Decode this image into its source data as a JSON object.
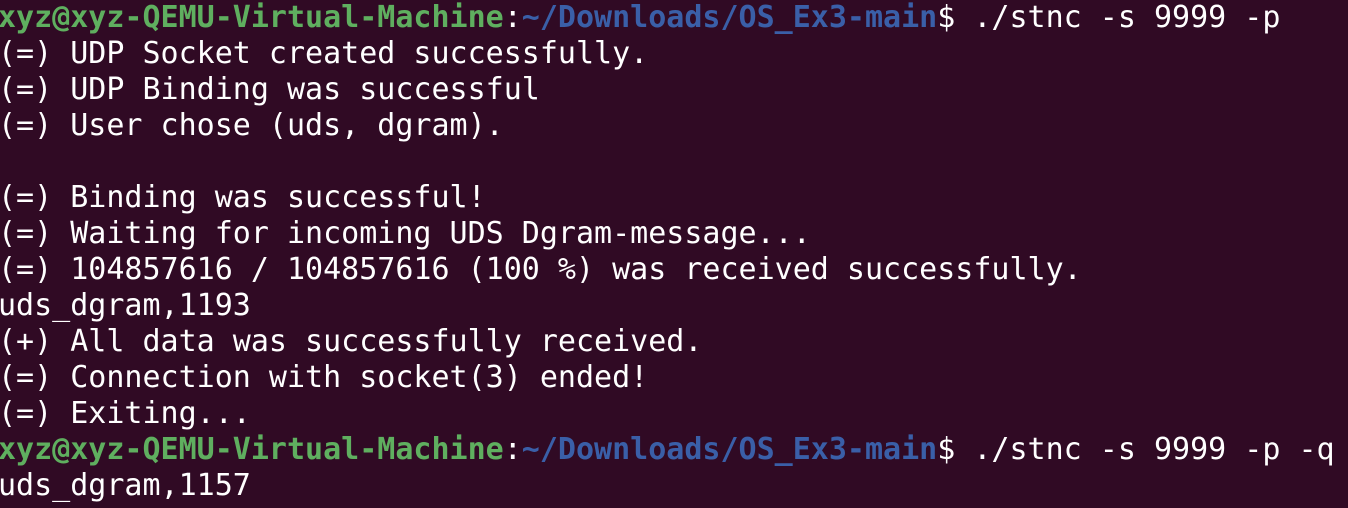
{
  "colors": {
    "background": "#300a24",
    "prompt_user": "#5faf5f",
    "prompt_path": "#3a5fa8",
    "text": "#ffffff"
  },
  "prompt": {
    "user_host": "xyz@xyz-QEMU-Virtual-Machine",
    "separator": ":",
    "path": "~/Downloads/OS_Ex3-main",
    "dollar": "$ "
  },
  "commands": {
    "first": "./stnc -s 9999 -p",
    "second": "./stnc -s 9999 -p -q"
  },
  "output": [
    "(=) UDP Socket created successfully.",
    "(=) UDP Binding was successful",
    "(=) User chose (uds, dgram).",
    "",
    "(=) Binding was successful!",
    "(=) Waiting for incoming UDS Dgram-message...",
    "(=) 104857616 / 104857616 (100 %) was received successfully.",
    "uds_dgram,1193",
    "(+) All data was successfully received.",
    "(=) Connection with socket(3) ended!",
    "(=) Exiting..."
  ],
  "final_output": "uds_dgram,1157"
}
